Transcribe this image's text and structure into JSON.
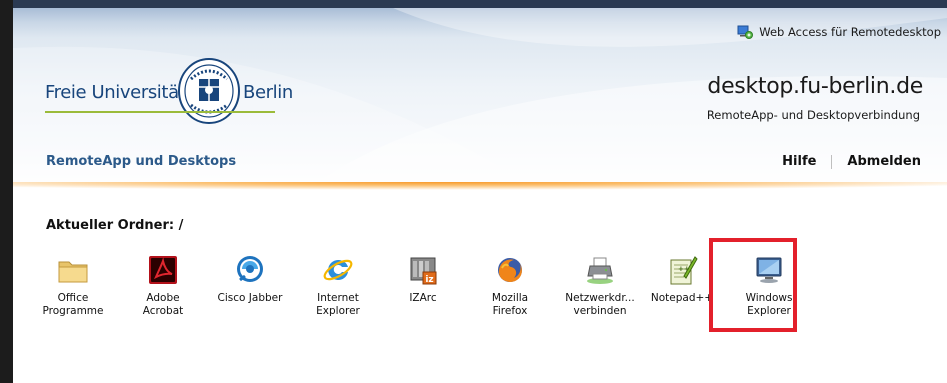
{
  "topbar": {
    "label": "Web Access für Remotedesktop",
    "icon": "remote-desktop-icon"
  },
  "logo": {
    "left": "Freie Universität",
    "right": "Berlin"
  },
  "site": {
    "title": "desktop.fu-berlin.de",
    "subtitle": "RemoteApp- und Desktopverbindung"
  },
  "nav": {
    "title": "RemoteApp und Desktops",
    "help": "Hilfe",
    "logout": "Abmelden"
  },
  "folder": {
    "label": "Aktueller Ordner: /"
  },
  "apps": [
    {
      "label": "Office\nProgramme",
      "icon": "folder-icon"
    },
    {
      "label": "Adobe\nAcrobat",
      "icon": "adobe-acrobat-icon"
    },
    {
      "label": "Cisco Jabber",
      "icon": "cisco-jabber-icon"
    },
    {
      "label": "Internet\nExplorer",
      "icon": "internet-explorer-icon"
    },
    {
      "label": "IZArc",
      "icon": "izarc-icon"
    },
    {
      "label": "Mozilla\nFirefox",
      "icon": "firefox-icon"
    },
    {
      "label": "Netzwerkdr...\nverbinden",
      "icon": "network-printer-icon"
    },
    {
      "label": "Notepad++",
      "icon": "notepad-plus-plus-icon"
    },
    {
      "label": "Windows\nExplorer",
      "icon": "windows-explorer-icon"
    }
  ],
  "colors": {
    "accent": "#18457c",
    "nav_title": "#2c5a8a",
    "highlight": "#e3202b",
    "orange": "#f79a2a",
    "logo_rule": "#9bbb3a"
  }
}
